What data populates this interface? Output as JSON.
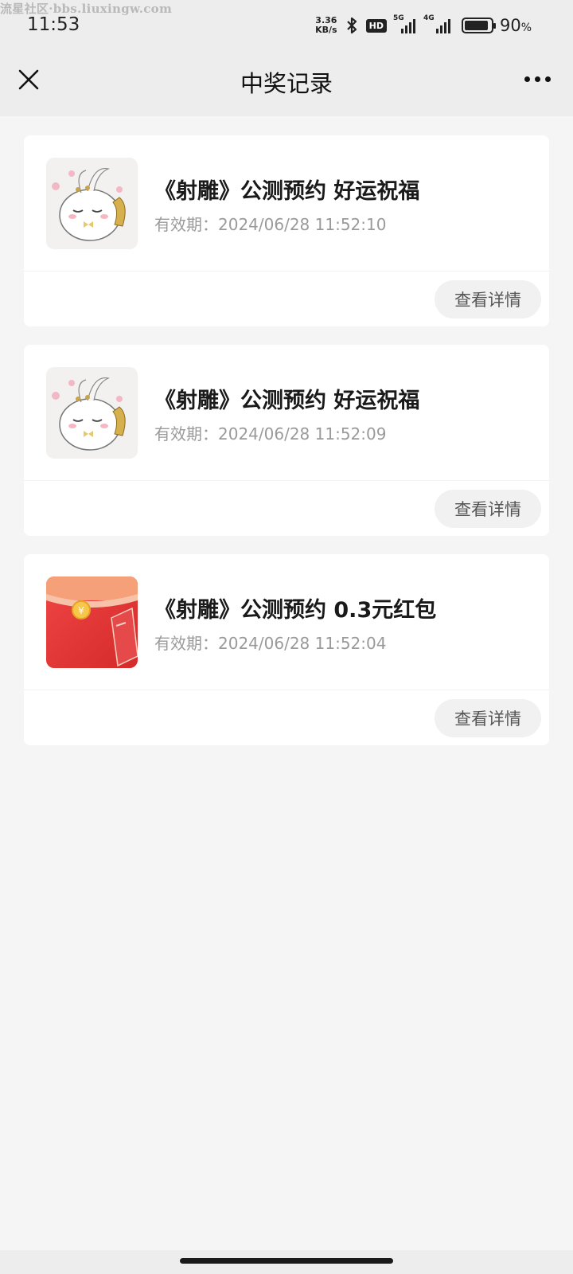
{
  "watermark": "流星社区·bbs.liuxingw.com",
  "status_bar": {
    "time": "11:53",
    "net_speed_value": "3.36",
    "net_speed_unit": "KB/s",
    "hd_badge": "HD",
    "sim1_label": "5G",
    "sim2_label": "4G",
    "battery_level": 0.9,
    "battery_value": "90",
    "battery_unit": "%"
  },
  "navbar": {
    "title": "中奖记录",
    "close_icon": "close-icon",
    "more_icon": "more-dots-icon"
  },
  "records": [
    {
      "thumb": "mascot-image",
      "title": "《射雕》公测预约 好运祝福",
      "validity_label": "有效期：",
      "validity_value": "2024/06/28 11:52:10",
      "button": "查看详情"
    },
    {
      "thumb": "mascot-image",
      "title": "《射雕》公测预约 好运祝福",
      "validity_label": "有效期：",
      "validity_value": "2024/06/28 11:52:09",
      "button": "查看详情"
    },
    {
      "thumb": "red-packet-image",
      "title": "《射雕》公测预约 0.3元红包",
      "validity_label": "有效期：",
      "validity_value": "2024/06/28 11:52:04",
      "button": "查看详情"
    }
  ],
  "colors": {
    "page_bg": "#f5f5f5",
    "bar_bg": "#ededed",
    "card_bg": "#ffffff",
    "muted_text": "#9a9a9a",
    "red_packet": "#e83a3a"
  }
}
